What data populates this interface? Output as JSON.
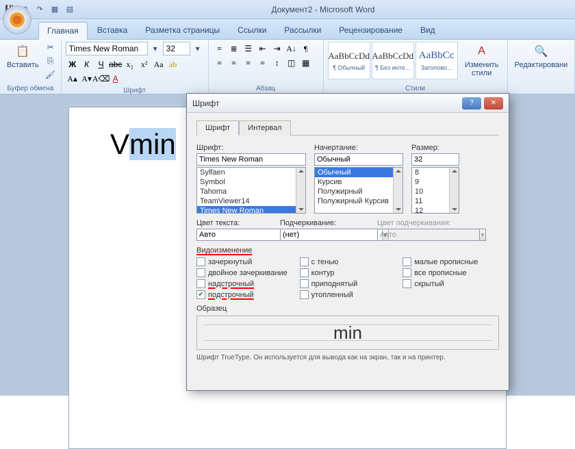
{
  "titlebar": {
    "title": "Документ2 - Microsoft Word"
  },
  "tabs": {
    "t0": "Главная",
    "t1": "Вставка",
    "t2": "Разметка страницы",
    "t3": "Ссылки",
    "t4": "Рассылки",
    "t5": "Рецензирование",
    "t6": "Вид"
  },
  "ribbon": {
    "clipboard": {
      "label": "Буфер обмена",
      "paste": "Вставить"
    },
    "font": {
      "label": "Шрифт",
      "name": "Times New Roman",
      "size": "32"
    },
    "paragraph": {
      "label": "Абзац"
    },
    "styles": {
      "label": "Стили",
      "s0": {
        "sample": "AaBbCcDd",
        "name": "¶ Обычный"
      },
      "s1": {
        "sample": "AaBbCcDd",
        "name": "¶ Без инте..."
      },
      "s2": {
        "sample": "AaBbCc",
        "name": "Заголово..."
      },
      "change": "Изменить стили"
    },
    "edit": {
      "label": "Редактировани"
    }
  },
  "doc": {
    "v": "V",
    "min": "min"
  },
  "dialog": {
    "title": "Шрифт",
    "tab_font": "Шрифт",
    "tab_spacing": "Интервал",
    "font_label": "Шрифт:",
    "font_value": "Times New Roman",
    "font_list": {
      "i0": "Sylfaen",
      "i1": "Symbol",
      "i2": "Tahoma",
      "i3": "TeamViewer14",
      "i4": "Times New Roman"
    },
    "style_label": "Начертание:",
    "style_value": "Обычный",
    "style_list": {
      "i0": "Обычный",
      "i1": "Курсив",
      "i2": "Полужирный",
      "i3": "Полужирный Курсив"
    },
    "size_label": "Размер:",
    "size_value": "32",
    "size_list": {
      "i0": "8",
      "i1": "9",
      "i2": "10",
      "i3": "11",
      "i4": "12"
    },
    "color_label": "Цвет текста:",
    "color_value": "Авто",
    "underline_label": "Подчеркивание:",
    "underline_value": "(нет)",
    "ulcolor_label": "Цвет подчеркивания:",
    "ulcolor_value": "Авто",
    "effects_header": "Видоизменение",
    "chk": {
      "strike": "зачеркнутый",
      "dblstrike": "двойное зачеркивание",
      "super": "надстрочный",
      "sub": "подстрочный",
      "shadow": "с тенью",
      "outline": "контур",
      "emboss": "приподнятый",
      "engrave": "утопленный",
      "smallcaps": "малые прописные",
      "allcaps": "все прописные",
      "hidden": "скрытый"
    },
    "preview_label": "Образец",
    "preview_text": "min",
    "hint": "Шрифт TrueType. Он используется для вывода как на экран, так и на принтер."
  }
}
